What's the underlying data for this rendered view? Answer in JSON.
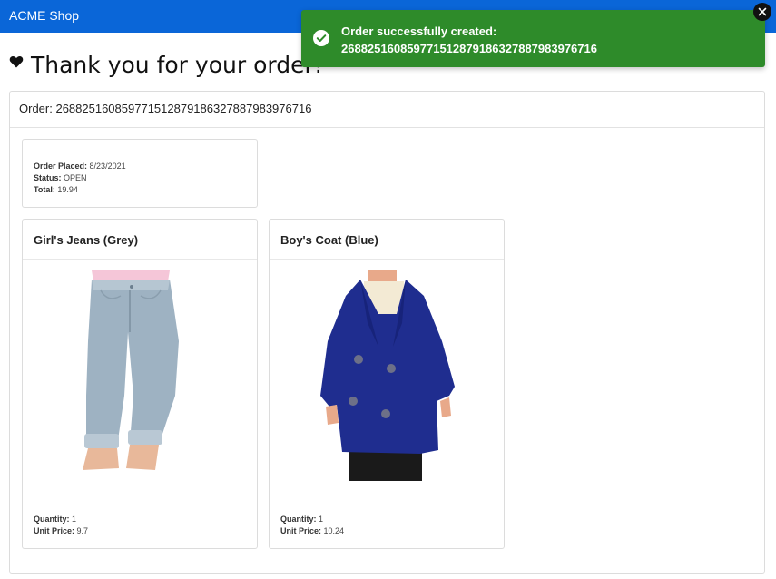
{
  "app": {
    "brand": "ACME Shop"
  },
  "page": {
    "heading": "Thank you for your order!",
    "heading_icon": "heart-icon"
  },
  "order": {
    "header_label": "Order:",
    "id": "26882516085977151287918632788798397671 6",
    "summary": {
      "placed_label": "Order Placed:",
      "placed_value": "8/23/2021",
      "status_label": "Status:",
      "status_value": "OPEN",
      "total_label": "Total:",
      "total_value": "19.94"
    },
    "items": [
      {
        "name": "Girl's Jeans (Grey)",
        "quantity_label": "Quantity:",
        "quantity": "1",
        "price_label": "Unit Price:",
        "price": "9.7",
        "image": "grey-jeans-image"
      },
      {
        "name": "Boy's Coat (Blue)",
        "quantity_label": "Quantity:",
        "quantity": "1",
        "price_label": "Unit Price:",
        "price": "10.24",
        "image": "blue-coat-image"
      }
    ]
  },
  "toast": {
    "title": "Order successfully created:",
    "id": "26882516085977151287918632788798397671 6",
    "icon": "check-circle-icon",
    "close_icon": "close-icon",
    "color": "#2e8b2a"
  },
  "colors": {
    "navbar": "#0a66d8",
    "toast": "#2e8b2a"
  }
}
